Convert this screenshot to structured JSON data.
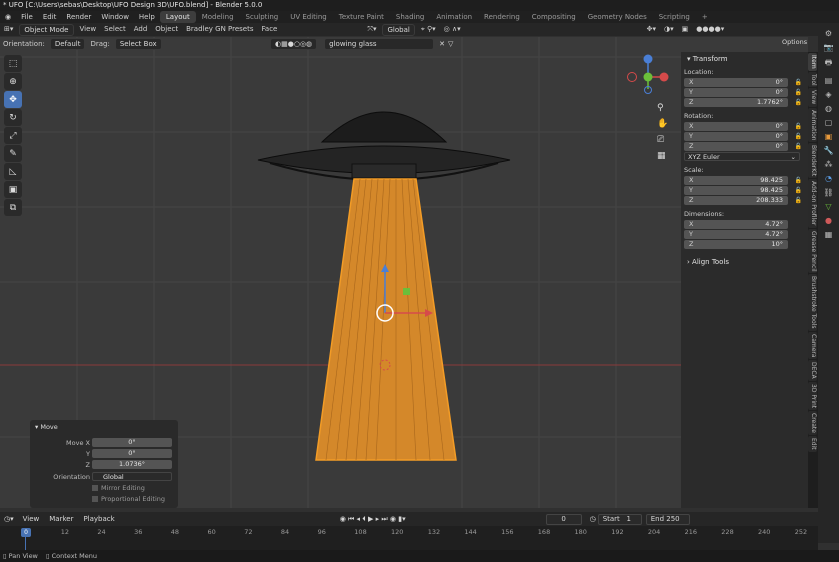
{
  "window_title": "* UFO [C:\\Users\\sebas\\Desktop\\UFO Design 3D\\UFO.blend] - Blender 5.0.0",
  "menu": [
    "File",
    "Edit",
    "Render",
    "Window",
    "Help"
  ],
  "workspaces": [
    "Layout",
    "Modeling",
    "Sculpting",
    "UV Editing",
    "Texture Paint",
    "Shading",
    "Animation",
    "Rendering",
    "Compositing",
    "Geometry Nodes",
    "Scripting"
  ],
  "viewport_header": {
    "mode": "Object Mode",
    "menus": [
      "View",
      "Select",
      "Add",
      "Object",
      "Bradley GN Presets",
      "Face"
    ],
    "transform_orientation": "Global",
    "search_value": "glowing glass",
    "options": "Options"
  },
  "tool_settings": {
    "orientation_label": "Orientation:",
    "orientation_value": "Default",
    "drag_label": "Drag:",
    "drag_value": "Select Box"
  },
  "npanel": {
    "title": "Transform",
    "location_label": "Location:",
    "location": [
      {
        "k": "X",
        "v": "0°"
      },
      {
        "k": "Y",
        "v": "0°"
      },
      {
        "k": "Z",
        "v": "1.7762°"
      }
    ],
    "rotation_label": "Rotation:",
    "rotation": [
      {
        "k": "X",
        "v": "0°"
      },
      {
        "k": "Y",
        "v": "0°"
      },
      {
        "k": "Z",
        "v": "0°"
      }
    ],
    "rotation_mode": "XYZ Euler",
    "scale_label": "Scale:",
    "scale": [
      {
        "k": "X",
        "v": "98.425"
      },
      {
        "k": "Y",
        "v": "98.425"
      },
      {
        "k": "Z",
        "v": "208.333"
      }
    ],
    "dimensions_label": "Dimensions:",
    "dimensions": [
      {
        "k": "X",
        "v": "4.72°"
      },
      {
        "k": "Y",
        "v": "4.72°"
      },
      {
        "k": "Z",
        "v": "10°"
      }
    ],
    "align_tools": "Align Tools"
  },
  "sidebar_tabs": [
    "Item",
    "Tool",
    "View",
    "Animation",
    "BlenderKit",
    "Add-on Profiler",
    "Grease Pencil",
    "Brushstroke Tools",
    "Camera",
    "DECA",
    "3D Print",
    "Create",
    "Edit"
  ],
  "operator_panel": {
    "title": "Move",
    "move_x_label": "Move X",
    "move_x": "0°",
    "y_label": "Y",
    "y": "0°",
    "z_label": "Z",
    "z": "1.0736°",
    "orientation_label": "Orientation",
    "orientation": "Global",
    "mirror": "Mirror Editing",
    "proportional": "Proportional Editing"
  },
  "timeline": {
    "menus": [
      "View",
      "Marker",
      "Playback"
    ],
    "current_frame": "0",
    "start_label": "Start",
    "start": "1",
    "end_label": "End",
    "end": "250",
    "ticks": [
      "0",
      "12",
      "24",
      "36",
      "48",
      "60",
      "72",
      "84",
      "96",
      "108",
      "120",
      "132",
      "144",
      "156",
      "168",
      "180",
      "192",
      "204",
      "216",
      "228",
      "240",
      "252"
    ]
  },
  "status_bar": {
    "left": "Pan View",
    "right": "Context Menu"
  },
  "colors": {
    "accent": "#4772b3",
    "selection": "#f39c26",
    "bg": "#303030"
  }
}
